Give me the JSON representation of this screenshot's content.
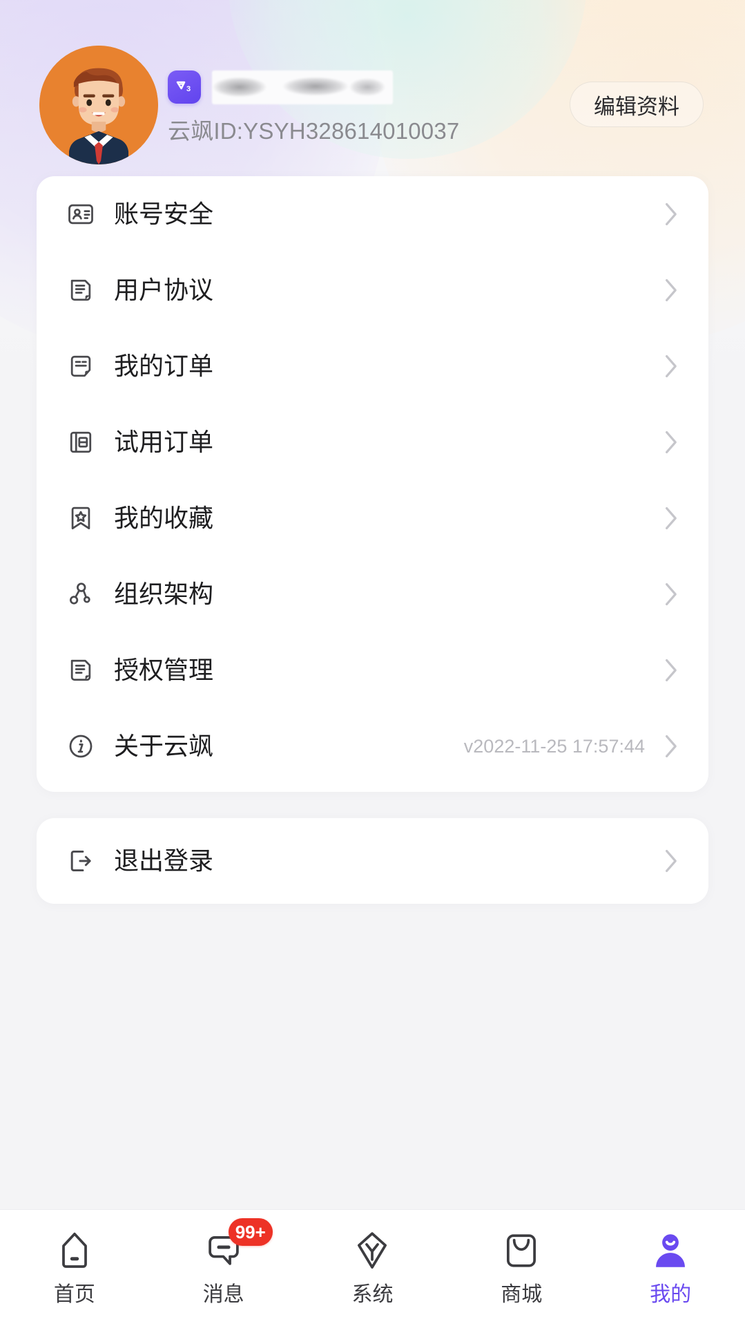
{
  "profile": {
    "avatar_alt": "user-avatar-illustration",
    "badge_label": "V3",
    "name_redacted": true,
    "user_id": "云飒ID:YSYH328614010037",
    "edit_button": "编辑资料"
  },
  "menu": {
    "items": [
      {
        "icon": "id-card-icon",
        "label": "账号安全",
        "value": ""
      },
      {
        "icon": "document-icon",
        "label": "用户协议",
        "value": ""
      },
      {
        "icon": "order-note-icon",
        "label": "我的订单",
        "value": ""
      },
      {
        "icon": "trial-book-icon",
        "label": "试用订单",
        "value": ""
      },
      {
        "icon": "bookmark-star-icon",
        "label": "我的收藏",
        "value": ""
      },
      {
        "icon": "org-tree-icon",
        "label": "组织架构",
        "value": ""
      },
      {
        "icon": "document-icon",
        "label": "授权管理",
        "value": ""
      },
      {
        "icon": "info-circle-icon",
        "label": "关于云飒",
        "value": "v2022-11-25 17:57:44"
      }
    ]
  },
  "logout": {
    "icon": "logout-icon",
    "label": "退出登录"
  },
  "tabbar": {
    "items": [
      {
        "icon": "home-icon",
        "label": "首页",
        "badge": "",
        "active": false
      },
      {
        "icon": "message-icon",
        "label": "消息",
        "badge": "99+",
        "active": false
      },
      {
        "icon": "system-icon",
        "label": "系统",
        "badge": "",
        "active": false
      },
      {
        "icon": "shop-icon",
        "label": "商城",
        "badge": "",
        "active": false
      },
      {
        "icon": "profile-icon",
        "label": "我的",
        "badge": "",
        "active": true
      }
    ]
  },
  "colors": {
    "accent": "#6A4AF0",
    "badge_red": "#ED3226",
    "card_bg": "#FFFFFF",
    "page_bg": "#F4F4F6",
    "text_primary": "#1E1E20",
    "text_muted": "#8A8A8F",
    "blob_purple": "#DDD5F5",
    "blob_cream": "#FAEBD6",
    "blob_mint": "#CFEEE8",
    "avatar_bg": "#E8822F"
  }
}
